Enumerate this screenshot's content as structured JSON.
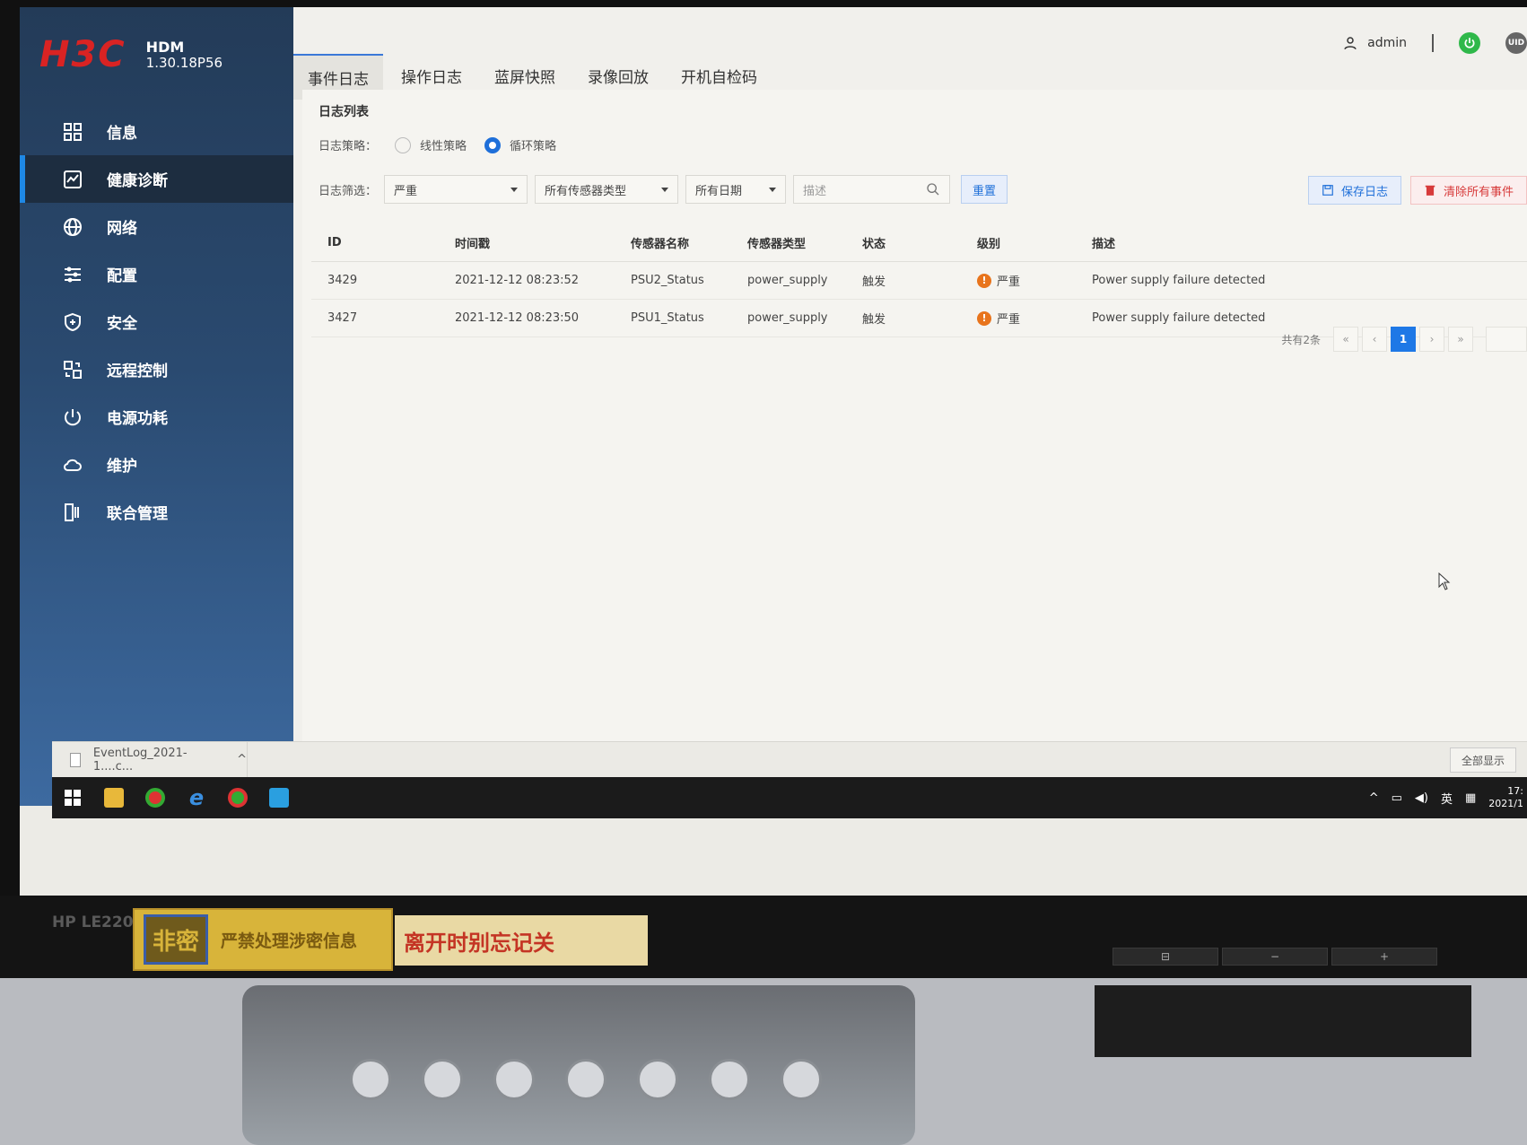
{
  "brand": {
    "logo": "H3C",
    "product": "HDM",
    "version": "1.30.18P56"
  },
  "sidebar": {
    "items": [
      {
        "label": "信息",
        "icon": "grid-icon",
        "active": false
      },
      {
        "label": "健康诊断",
        "icon": "health-chart-icon",
        "active": true
      },
      {
        "label": "网络",
        "icon": "globe-icon",
        "active": false
      },
      {
        "label": "配置",
        "icon": "list-settings-icon",
        "active": false
      },
      {
        "label": "安全",
        "icon": "shield-icon",
        "active": false
      },
      {
        "label": "远程控制",
        "icon": "remote-icon",
        "active": false
      },
      {
        "label": "电源功耗",
        "icon": "power-icon",
        "active": false
      },
      {
        "label": "维护",
        "icon": "cloud-icon",
        "active": false
      },
      {
        "label": "联合管理",
        "icon": "server-icon",
        "active": false
      }
    ]
  },
  "header": {
    "tabs": [
      "事件日志",
      "操作日志",
      "蓝屏快照",
      "录像回放",
      "开机自检码"
    ],
    "active_tab": 0,
    "user": "admin",
    "uid_label": "UID"
  },
  "panel": {
    "title": "日志列表",
    "policy_label": "日志策略：",
    "policy_linear": "线性策略",
    "policy_cyclic": "循环策略",
    "filter_label": "日志筛选：",
    "severity_value": "严重",
    "sensor_type_value": "所有传感器类型",
    "date_value": "所有日期",
    "search_placeholder": "描述",
    "reset_label": "重置",
    "save_label": "保存日志",
    "clear_label": "清除所有事件"
  },
  "table": {
    "headers": [
      "ID",
      "时间戳",
      "传感器名称",
      "传感器类型",
      "状态",
      "级别",
      "描述"
    ],
    "rows": [
      {
        "id": "3429",
        "time": "2021-12-12 08:23:52",
        "sensor": "PSU2_Status",
        "type": "power_supply",
        "state": "触发",
        "level": "严重",
        "desc": "Power supply failure detected"
      },
      {
        "id": "3427",
        "time": "2021-12-12 08:23:50",
        "sensor": "PSU1_Status",
        "type": "power_supply",
        "state": "触发",
        "level": "严重",
        "desc": "Power supply failure detected"
      }
    ]
  },
  "pager": {
    "total": "共有2条",
    "current": "1",
    "first": "«",
    "prev": "‹",
    "next": "›",
    "last": "»"
  },
  "download": {
    "file": "EventLog_2021-1....c...",
    "show_all": "全部显示"
  },
  "tray": {
    "lang": "英",
    "time": "17:",
    "date": "2021/1"
  },
  "bezel": {
    "brand": "HP LE2201",
    "sticker1": "严禁处理涉密信息",
    "sticker1_badge": "非密",
    "sticker2": "离开时别忘记关"
  },
  "colors": {
    "accent": "#1e78e6",
    "danger": "#d73a3a",
    "warn": "#e8741c",
    "logo": "#d92323"
  }
}
